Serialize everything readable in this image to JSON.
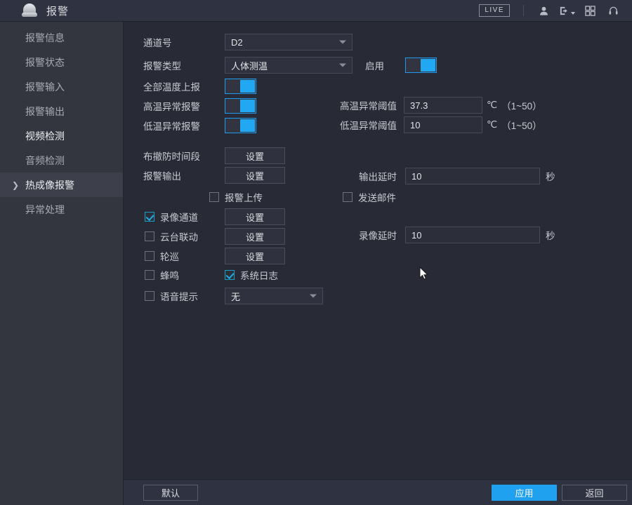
{
  "titlebar": {
    "title": "报警",
    "icon": "alarm-siren-icon",
    "live_label": "LIVE",
    "icons": [
      "user-icon",
      "logout-icon",
      "grid-icon",
      "headset-icon"
    ]
  },
  "sidebar": {
    "items": [
      {
        "label": "报警信息",
        "selected": false,
        "bold": false
      },
      {
        "label": "报警状态",
        "selected": false,
        "bold": false
      },
      {
        "label": "报警输入",
        "selected": false,
        "bold": false
      },
      {
        "label": "报警输出",
        "selected": false,
        "bold": false
      },
      {
        "label": "视频检测",
        "selected": false,
        "bold": true
      },
      {
        "label": "音频检测",
        "selected": false,
        "bold": false
      },
      {
        "label": "热成像报警",
        "selected": true,
        "bold": false
      },
      {
        "label": "异常处理",
        "selected": false,
        "bold": false
      }
    ]
  },
  "form": {
    "channel_label": "通道号",
    "channel_value": "D2",
    "alarm_type_label": "报警类型",
    "alarm_type_value": "人体测温",
    "enable_label": "启用",
    "enable_on": true,
    "report_all_temp_label": "全部温度上报",
    "report_all_temp_on": true,
    "high_temp_alarm_label": "高温异常报警",
    "high_temp_alarm_on": true,
    "low_temp_alarm_label": "低温异常报警",
    "low_temp_alarm_on": true,
    "high_threshold_label": "高温异常阈值",
    "high_threshold_value": "37.3",
    "low_threshold_label": "低温异常阈值",
    "low_threshold_value": "10",
    "unit_celsius": "℃",
    "range_hint": "（1~50）",
    "schedule_label": "布撤防时间段",
    "schedule_button": "设置",
    "alarm_out_label": "报警输出",
    "alarm_out_button": "设置",
    "out_delay_label": "输出延时",
    "out_delay_value": "10",
    "seconds_unit": "秒",
    "alarm_upload_label": "报警上传",
    "alarm_upload_checked": false,
    "send_mail_label": "发送邮件",
    "send_mail_checked": false,
    "record_channel_label": "录像通道",
    "record_channel_checked": true,
    "record_channel_button": "设置",
    "ptz_link_label": "云台联动",
    "ptz_link_checked": false,
    "ptz_link_button": "设置",
    "record_delay_label": "录像延时",
    "record_delay_value": "10",
    "tour_label": "轮巡",
    "tour_checked": false,
    "tour_button": "设置",
    "buzzer_label": "蜂鸣",
    "buzzer_checked": false,
    "syslog_label": "系统日志",
    "syslog_checked": true,
    "voice_prompt_label": "语音提示",
    "voice_prompt_checked": false,
    "voice_prompt_value": "无"
  },
  "bottombar": {
    "default_label": "默认",
    "apply_label": "应用",
    "back_label": "返回"
  },
  "colors": {
    "accent": "#1fa1f0",
    "toggle_on": "#22a7f2",
    "window_bg": "#282a35",
    "sidebar_bg": "#33363f",
    "titlebar_bg": "#2f3240"
  }
}
